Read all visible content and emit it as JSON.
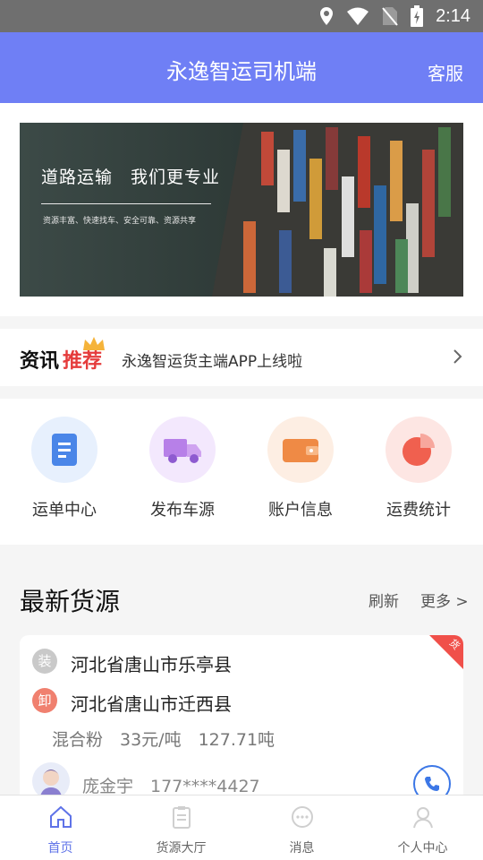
{
  "status_bar": {
    "time": "2:14"
  },
  "header": {
    "title": "永逸智运司机端",
    "service": "客服"
  },
  "banner": {
    "slogan": "道路运输　我们更专业",
    "sub": "资源丰富、快速找车、安全可靠、资源共享"
  },
  "news": {
    "tag_a": "资讯",
    "tag_b": "推荐",
    "text": "永逸智运货主端APP上线啦"
  },
  "quick_menu": [
    {
      "label": "运单中心",
      "icon": "waybill-icon",
      "color": "#4a86e8"
    },
    {
      "label": "发布车源",
      "icon": "truck-icon",
      "color": "#b780e8"
    },
    {
      "label": "账户信息",
      "icon": "wallet-icon",
      "color": "#ef8a45"
    },
    {
      "label": "运费统计",
      "icon": "pie-chart-icon",
      "color": "#f0604f"
    }
  ],
  "goods": {
    "title": "最新货源",
    "refresh": "刷新",
    "more": "更多 >",
    "card": {
      "corner": "货",
      "load_badge": "装",
      "load_addr": "河北省唐山市乐亭县",
      "unload_badge": "卸",
      "unload_addr": "河北省唐山市迁西县",
      "cargo": "混合粉　33元/吨　127.71吨",
      "driver": "庞金宇　177****4427"
    }
  },
  "tabs": [
    {
      "label": "首页",
      "icon": "home-icon",
      "active": true
    },
    {
      "label": "货源大厅",
      "icon": "clipboard-icon",
      "active": false
    },
    {
      "label": "消息",
      "icon": "message-icon",
      "active": false
    },
    {
      "label": "个人中心",
      "icon": "person-icon",
      "active": false
    }
  ]
}
